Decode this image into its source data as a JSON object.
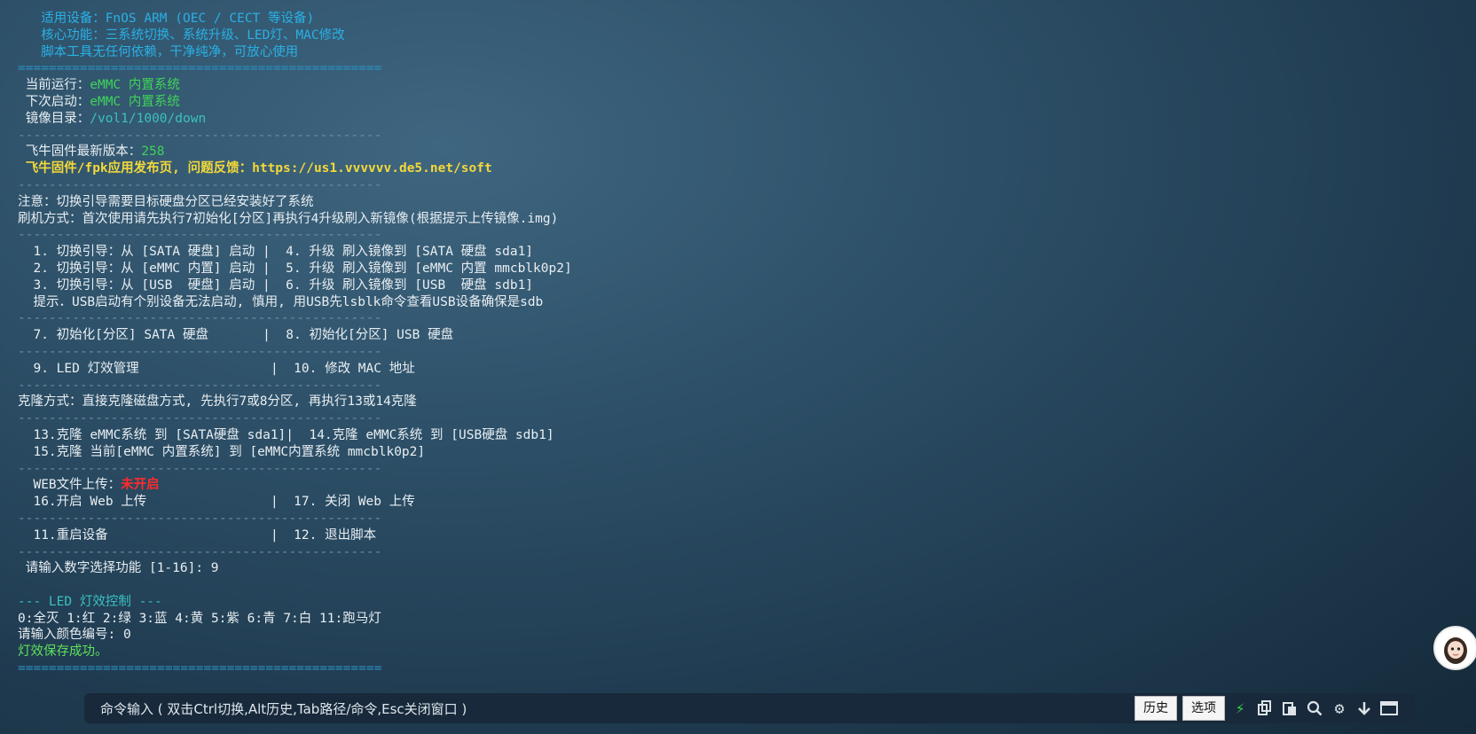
{
  "lines": [
    {
      "parts": [
        {
          "t": "   适用设备：FnOS ARM (OEC / CECT 等设备)",
          "c": "cyan"
        }
      ]
    },
    {
      "parts": [
        {
          "t": "   核心功能：三系统切换、系统升级、LED灯、MAC修改",
          "c": "cyan"
        }
      ]
    },
    {
      "parts": [
        {
          "t": "   脚本工具无任何依赖，干净纯净，可放心使用",
          "c": "cyan"
        }
      ]
    },
    {
      "parts": [
        {
          "t": "===============================================",
          "c": "sep"
        }
      ]
    },
    {
      "parts": [
        {
          "t": " 当前运行：",
          "c": ""
        },
        {
          "t": "eMMC 内置系统",
          "c": "green"
        }
      ]
    },
    {
      "parts": [
        {
          "t": " 下次启动：",
          "c": ""
        },
        {
          "t": "eMMC 内置系统",
          "c": "green"
        }
      ]
    },
    {
      "parts": [
        {
          "t": " 镜像目录：",
          "c": ""
        },
        {
          "t": "/vol1/1000/down",
          "c": "teal"
        }
      ]
    },
    {
      "parts": [
        {
          "t": "-----------------------------------------------",
          "c": "dash"
        }
      ]
    },
    {
      "parts": [
        {
          "t": " 飞牛固件最新版本：",
          "c": ""
        },
        {
          "t": "258",
          "c": "green"
        }
      ]
    },
    {
      "parts": [
        {
          "t": " 飞牛固件/fpk应用发布页, 问题反馈：https://us1.vvvvvv.de5.net/soft",
          "c": "yellow"
        }
      ]
    },
    {
      "parts": [
        {
          "t": "-----------------------------------------------",
          "c": "dash"
        }
      ]
    },
    {
      "parts": [
        {
          "t": "注意：切换引导需要目标硬盘分区已经安装好了系统",
          "c": ""
        }
      ]
    },
    {
      "parts": [
        {
          "t": "刷机方式：首次使用请先执行7初始化[分区]再执行4升级刷入新镜像(根据提示上传镜像.img)",
          "c": ""
        }
      ]
    },
    {
      "parts": [
        {
          "t": "-----------------------------------------------",
          "c": "dash"
        }
      ]
    },
    {
      "parts": [
        {
          "t": "  1. 切换引导：从 [SATA 硬盘] 启动 |  4. 升级 刷入镜像到 [SATA 硬盘 sda1]",
          "c": ""
        }
      ]
    },
    {
      "parts": [
        {
          "t": "  2. 切换引导：从 [eMMC 内置] 启动 |  5. 升级 刷入镜像到 [eMMC 内置 mmcblk0p2]",
          "c": ""
        }
      ]
    },
    {
      "parts": [
        {
          "t": "  3. 切换引导：从 [USB  硬盘] 启动 |  6. 升级 刷入镜像到 [USB  硬盘 sdb1]",
          "c": ""
        }
      ]
    },
    {
      "parts": [
        {
          "t": "  提示．USB启动有个别设备无法启动, 慎用, 用USB先lsblk命令查看USB设备确保是sdb",
          "c": ""
        }
      ]
    },
    {
      "parts": [
        {
          "t": "-----------------------------------------------",
          "c": "dash"
        }
      ]
    },
    {
      "parts": [
        {
          "t": "  7. 初始化[分区] SATA 硬盘       |  8. 初始化[分区] USB 硬盘",
          "c": ""
        }
      ]
    },
    {
      "parts": [
        {
          "t": "-----------------------------------------------",
          "c": "dash"
        }
      ]
    },
    {
      "parts": [
        {
          "t": "  9. LED 灯效管理                 |  10. 修改 MAC 地址",
          "c": ""
        }
      ]
    },
    {
      "parts": [
        {
          "t": "-----------------------------------------------",
          "c": "dash"
        }
      ]
    },
    {
      "parts": [
        {
          "t": "克隆方式：直接克隆磁盘方式, 先执行7或8分区, 再执行13或14克隆",
          "c": ""
        }
      ]
    },
    {
      "parts": [
        {
          "t": "-----------------------------------------------",
          "c": "dash"
        }
      ]
    },
    {
      "parts": [
        {
          "t": "  13.克隆 eMMC系统 到 [SATA硬盘 sda1]|  14.克隆 eMMC系统 到 [USB硬盘 sdb1]",
          "c": ""
        }
      ]
    },
    {
      "parts": [
        {
          "t": "  15.克隆 当前[eMMC 内置系统] 到 [eMMC内置系统 mmcblk0p2]",
          "c": ""
        }
      ]
    },
    {
      "parts": [
        {
          "t": "-----------------------------------------------",
          "c": "dash"
        }
      ]
    },
    {
      "parts": [
        {
          "t": "  WEB文件上传：",
          "c": ""
        },
        {
          "t": "未开启",
          "c": "red"
        }
      ]
    },
    {
      "parts": [
        {
          "t": "  16.开启 Web 上传                |  17. 关闭 Web 上传",
          "c": ""
        }
      ]
    },
    {
      "parts": [
        {
          "t": "-----------------------------------------------",
          "c": "dash"
        }
      ]
    },
    {
      "parts": [
        {
          "t": "  11.重启设备                     |  12. 退出脚本",
          "c": ""
        }
      ]
    },
    {
      "parts": [
        {
          "t": "-----------------------------------------------",
          "c": "dash"
        }
      ]
    },
    {
      "parts": [
        {
          "t": " 请输入数字选择功能 [1-16]: 9",
          "c": ""
        }
      ]
    },
    {
      "parts": [
        {
          "t": "",
          "c": ""
        }
      ]
    },
    {
      "parts": [
        {
          "t": "--- LED 灯效控制 ---",
          "c": "teal"
        }
      ]
    },
    {
      "parts": [
        {
          "t": "0:全灭 1:红 2:绿 3:蓝 4:黄 5:紫 6:青 7:白 11:跑马灯",
          "c": ""
        }
      ]
    },
    {
      "parts": [
        {
          "t": "请输入颜色编号: 0",
          "c": ""
        }
      ]
    },
    {
      "parts": [
        {
          "t": "灯效保存成功。",
          "c": "lime"
        }
      ]
    },
    {
      "parts": [
        {
          "t": "===============================================",
          "c": "sep"
        }
      ]
    }
  ],
  "cmdbar": {
    "label": "命令输入 ( 双击Ctrl切换,Alt历史,Tab路径/命令,Esc关闭窗口 )",
    "history_label": "历史",
    "options_label": "选项"
  },
  "icons": [
    "bolt-icon",
    "copy-icon",
    "paste-icon",
    "search-icon",
    "gear-icon",
    "download-icon",
    "window-icon",
    "avatar"
  ]
}
